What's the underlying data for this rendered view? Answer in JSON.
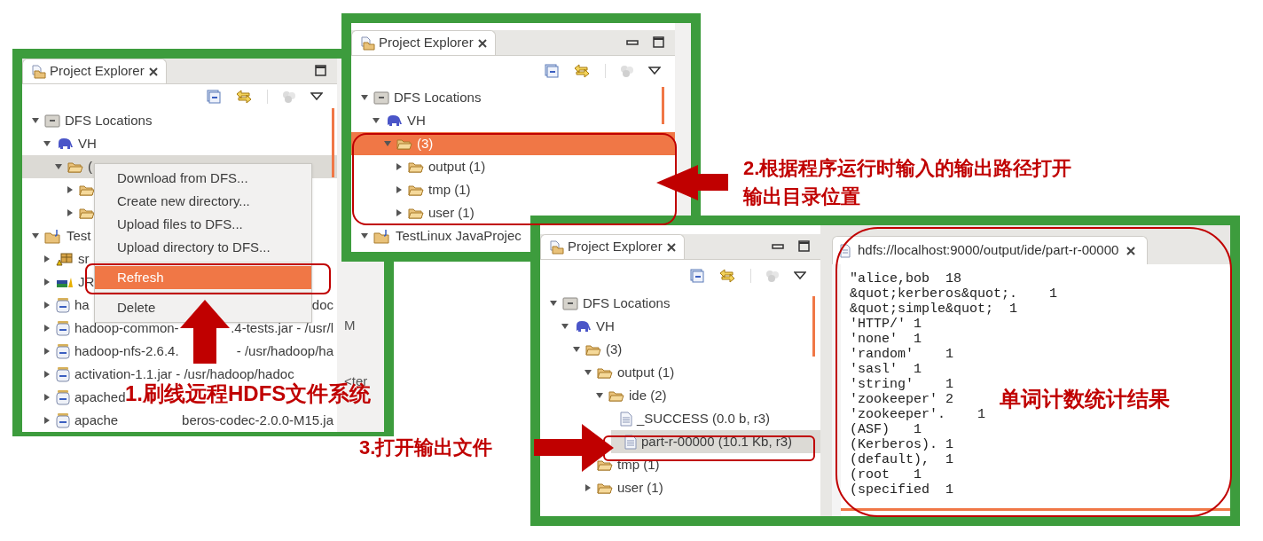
{
  "panels": [
    {
      "kind": "explorer",
      "focused": false,
      "tab": "Project Explorer",
      "side_texts": [
        "M",
        "<ter"
      ],
      "tree": [
        {
          "kind": "dfs",
          "label": "DFS Locations",
          "expanded": true,
          "selected": false,
          "children": [
            {
              "kind": "elephant",
              "label": "VH",
              "expanded": true,
              "selected": false,
              "children": [
                {
                  "kind": "folder",
                  "label": "(",
                  "expanded": true,
                  "selected": true,
                  "children": [
                    {
                      "kind": "folder",
                      "expanded": false,
                      "selected": false
                    },
                    {
                      "kind": "folder",
                      "expanded": false,
                      "selected": false
                    }
                  ]
                }
              ]
            }
          ]
        },
        {
          "kind": "project",
          "label": "Test",
          "expanded": true,
          "selected": false,
          "children": [
            {
              "kind": "source",
              "label": "sr",
              "expanded": false,
              "selected": false
            },
            {
              "kind": "library",
              "label": "JR",
              "expanded": false,
              "selected": false
            },
            {
              "kind": "jar",
              "label": "ha",
              "tail": "doc",
              "expanded": false,
              "selected": false
            },
            {
              "kind": "jar",
              "label": "hadoop-common-",
              "tail": ".4-tests.jar - /usr/l",
              "expanded": false,
              "selected": false
            },
            {
              "kind": "jar",
              "label": "hadoop-nfs-2.6.4.",
              "tail": "- /usr/hadoop/ha",
              "expanded": false,
              "selected": false
            },
            {
              "kind": "jar",
              "label": "activation-1.1.jar - /usr/hadoop/hadoc",
              "expanded": false,
              "selected": false
            },
            {
              "kind": "jar",
              "label": "apached",
              "expanded": false,
              "selected": false
            },
            {
              "kind": "jar",
              "label": "apache",
              "tail": "beros-codec-2.0.0-M15.ja",
              "expanded": false,
              "selected": false
            }
          ]
        }
      ],
      "menu": [
        {
          "label": "Download from DFS...",
          "selected": false
        },
        {
          "label": "Create new directory...",
          "selected": false
        },
        {
          "label": "Upload files to DFS...",
          "selected": false
        },
        {
          "label": "Upload directory to DFS...",
          "selected": false
        },
        {
          "label": "Refresh",
          "selected": true
        },
        {
          "label": "Delete",
          "selected": false
        }
      ]
    },
    {
      "kind": "explorer",
      "focused": true,
      "tab": "Project Explorer",
      "tree": [
        {
          "kind": "dfs",
          "label": "DFS Locations",
          "expanded": true,
          "selected": false,
          "children": [
            {
              "kind": "elephant",
              "label": "VH",
              "expanded": true,
              "selected": false,
              "children": [
                {
                  "kind": "folder",
                  "label": "(3)",
                  "expanded": true,
                  "selected": true,
                  "children": [
                    {
                      "kind": "folder",
                      "label": "output (1)",
                      "expanded": false,
                      "selected": false
                    },
                    {
                      "kind": "folder",
                      "label": "tmp (1)",
                      "expanded": false,
                      "selected": false
                    },
                    {
                      "kind": "folder",
                      "label": "user (1)",
                      "expanded": false,
                      "selected": false
                    }
                  ]
                }
              ]
            }
          ]
        },
        {
          "kind": "project",
          "label": "TestLinux JavaProjec",
          "expanded": true,
          "selected": false
        }
      ]
    },
    {
      "kind": "explorer_editor",
      "focused": false,
      "tab": "Project Explorer",
      "tree": [
        {
          "kind": "dfs",
          "label": "DFS Locations",
          "expanded": true,
          "selected": false,
          "children": [
            {
              "kind": "elephant",
              "label": "VH",
              "expanded": true,
              "selected": false,
              "children": [
                {
                  "kind": "folder",
                  "label": "(3)",
                  "expanded": true,
                  "selected": false,
                  "children": [
                    {
                      "kind": "folder",
                      "label": "output (1)",
                      "expanded": true,
                      "selected": false,
                      "children": [
                        {
                          "kind": "folder",
                          "label": "ide (2)",
                          "expanded": true,
                          "selected": false,
                          "children": [
                            {
                              "kind": "file",
                              "label": "_SUCCESS (0.0 b, r3)",
                              "selected": false
                            },
                            {
                              "kind": "file",
                              "label": "part-r-00000 (10.1 Kb, r3)",
                              "selected": true
                            }
                          ]
                        }
                      ]
                    },
                    {
                      "kind": "folder",
                      "label": "tmp (1)",
                      "expanded": false,
                      "selected": false
                    },
                    {
                      "kind": "folder",
                      "label": "user (1)",
                      "expanded": false,
                      "selected": false
                    }
                  ]
                }
              ]
            }
          ]
        }
      ],
      "editor": {
        "tab": "hdfs://localhost:9000/output/ide/part-r-00000",
        "lines": [
          "\"alice,bob  18",
          "&quot;kerberos&quot;.    1",
          "&quot;simple&quot;  1",
          "'HTTP/' 1",
          "'none'  1",
          "'random'    1",
          "'sasl'  1",
          "'string'    1",
          "'zookeeper' 2",
          "'zookeeper'.    1",
          "(ASF)   1",
          "(Kerberos). 1",
          "(default),  1",
          "(root   1",
          "(specified  1"
        ]
      }
    }
  ],
  "annotations": [
    {
      "text": "1.刷线远程HDFS文件系统"
    },
    {
      "text": "2.根据程序运行时输入的输出路径打开输出目录位置"
    },
    {
      "text": "3.打开输出文件"
    },
    {
      "text": "单词计数统计结果"
    }
  ]
}
